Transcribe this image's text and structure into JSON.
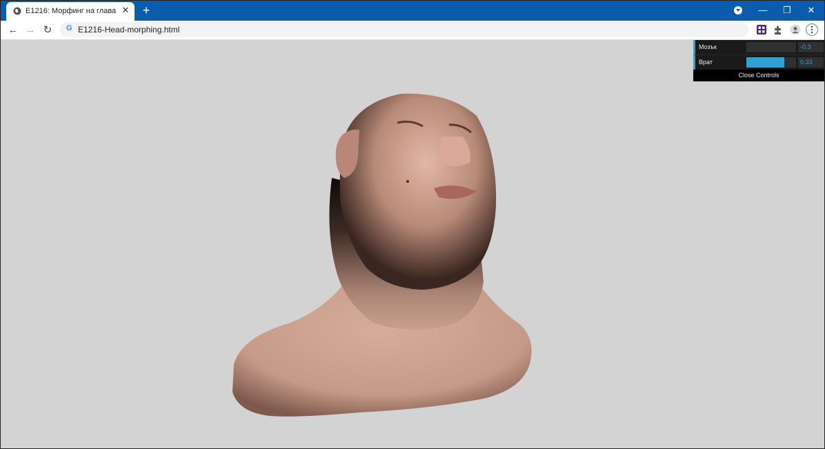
{
  "tab": {
    "title": "E1216: Морфинг на глава",
    "close": "✕"
  },
  "new_tab": "+",
  "window": {
    "minimize": "—",
    "restore": "❐",
    "close": "✕"
  },
  "omnibox": {
    "url": "E1216-Head-morphing.html",
    "engine_icon": "G"
  },
  "controls": {
    "items": [
      {
        "label": "Мозък",
        "value": "-0.3",
        "level": 0.0
      },
      {
        "label": "Врат",
        "value": "0.33",
        "level": 0.76
      }
    ],
    "close_label": "Close Controls",
    "accent": "#2fa1d6"
  },
  "colors": {
    "tabstrip": "#0b5cad",
    "canvas_bg": "#d3d3d3",
    "skin": "#c9a090"
  }
}
